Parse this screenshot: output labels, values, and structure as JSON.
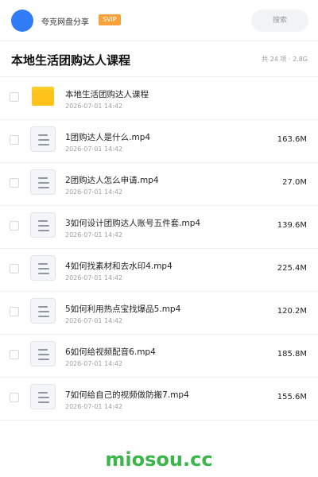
{
  "header": {
    "share_name": "夸克网盘分享",
    "badge": "SVIP",
    "search_placeholder": "搜索"
  },
  "folder": {
    "title": "本地生活团购达人课程",
    "meta": "共 24 项 · 2.8G"
  },
  "files": [
    {
      "name": "本地生活团购达人课程",
      "date": "2026-07-01 14:42",
      "size": "",
      "type": "folder"
    },
    {
      "name": "1团购达人是什么.mp4",
      "date": "2026-07-01 14:42",
      "size": "163.6M",
      "type": "video"
    },
    {
      "name": "2团购达人怎么申请.mp4",
      "date": "2026-07-01 14:42",
      "size": "27.0M",
      "type": "video"
    },
    {
      "name": "3如何设计团购达人账号五件套.mp4",
      "date": "2026-07-01 14:42",
      "size": "139.6M",
      "type": "video"
    },
    {
      "name": "4如何找素材和去水印4.mp4",
      "date": "2026-07-01 14:42",
      "size": "225.4M",
      "type": "video"
    },
    {
      "name": "5如何利用热点宝找爆品5.mp4",
      "date": "2026-07-01 14:42",
      "size": "120.2M",
      "type": "video"
    },
    {
      "name": "6如何给视频配音6.mp4",
      "date": "2026-07-01 14:42",
      "size": "185.8M",
      "type": "video"
    },
    {
      "name": "7如何给自己的视频做防搬7.mp4",
      "date": "2026-07-01 14:42",
      "size": "155.6M",
      "type": "video"
    }
  ],
  "watermark": "miosou.cc",
  "colors": {
    "avatar": "#2f7cf6",
    "badge": "#f7a23b",
    "folder": "#ffc21a",
    "watermark": "#3cb64a"
  }
}
